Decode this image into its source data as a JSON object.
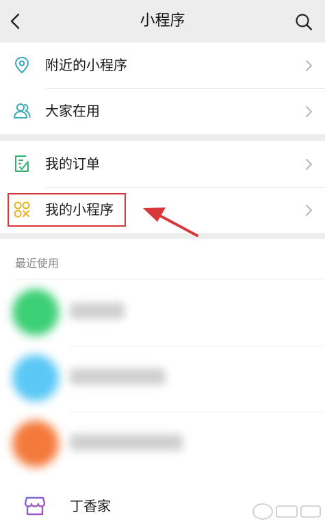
{
  "header": {
    "title": "小程序",
    "back_icon": "chevron-left-icon",
    "search_icon": "search-icon"
  },
  "menu_group_1": {
    "items": [
      {
        "label": "附近的小程序",
        "icon": "location-pin-icon"
      },
      {
        "label": "大家在用",
        "icon": "people-icon"
      }
    ]
  },
  "menu_group_2": {
    "items": [
      {
        "label": "我的订单",
        "icon": "order-list-icon"
      },
      {
        "label": "我的小程序",
        "icon": "mini-program-icon"
      }
    ]
  },
  "recent": {
    "title": "最近使用",
    "items": [
      {
        "label": "",
        "color": "#3ccf75"
      },
      {
        "label": "",
        "color": "#5ac8f5"
      },
      {
        "label": "",
        "color": "#f47a3c"
      },
      {
        "label": "丁香家",
        "icon": "store-icon"
      }
    ]
  },
  "annotation": {
    "highlight_color": "#d8383a"
  },
  "colors": {
    "accent_teal": "#3aa8b8",
    "accent_green": "#2bb46a",
    "accent_yellow": "#e8b21c",
    "store_purple": "#8a55cf",
    "background": "#ededed"
  }
}
